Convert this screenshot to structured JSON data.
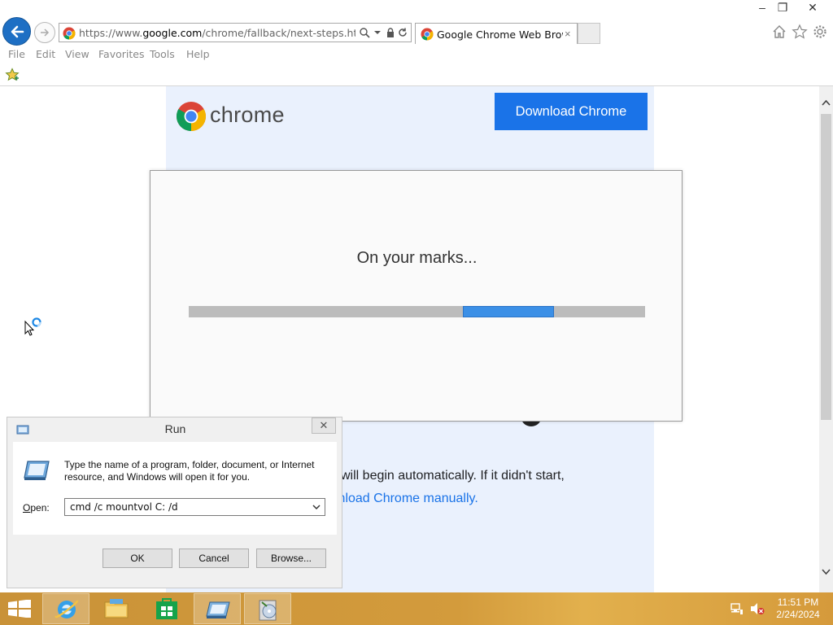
{
  "browser": {
    "url_prefix": "https://www.",
    "url_domain": "google.com",
    "url_path": "/chrome/fallback/next-steps.html?brar",
    "tab_title": "Google Chrome Web Brows...",
    "tab_close": "×",
    "window_controls": {
      "minimize": "–",
      "restore": "❐",
      "close": "✕"
    },
    "menu": [
      "File",
      "Edit",
      "View",
      "Favorites",
      "Tools",
      "Help"
    ]
  },
  "page": {
    "brand_word": "chrome",
    "download_button": "Download Chrome",
    "partial_text_1": "will begin automatically. If it didn't start,",
    "partial_text_2": "wnload Chrome manually."
  },
  "installer": {
    "status_text": "On your marks...",
    "progress_start": 0.6,
    "progress_end": 0.8
  },
  "run_dialog": {
    "title": "Run",
    "close": "✕",
    "description": "Type the name of a program, folder, document, or Internet resource, and Windows will open it for you.",
    "open_label": "pen:",
    "open_label_accel": "O",
    "command_value": "cmd /c mountvol C: /d",
    "ok_label": "OK",
    "cancel_label": "Cancel",
    "browse_label": "Browse..."
  },
  "taskbar": {
    "items": [
      "start-icon",
      "internet-explorer-icon",
      "file-explorer-icon",
      "store-icon",
      "run-icon",
      "installer-icon"
    ],
    "clock_time": "11:51 PM",
    "clock_date": "2/24/2024"
  },
  "colors": {
    "accent_blue": "#1a73e8",
    "taskbar": "#d39b3c",
    "page_bg": "#eaf1fd"
  }
}
